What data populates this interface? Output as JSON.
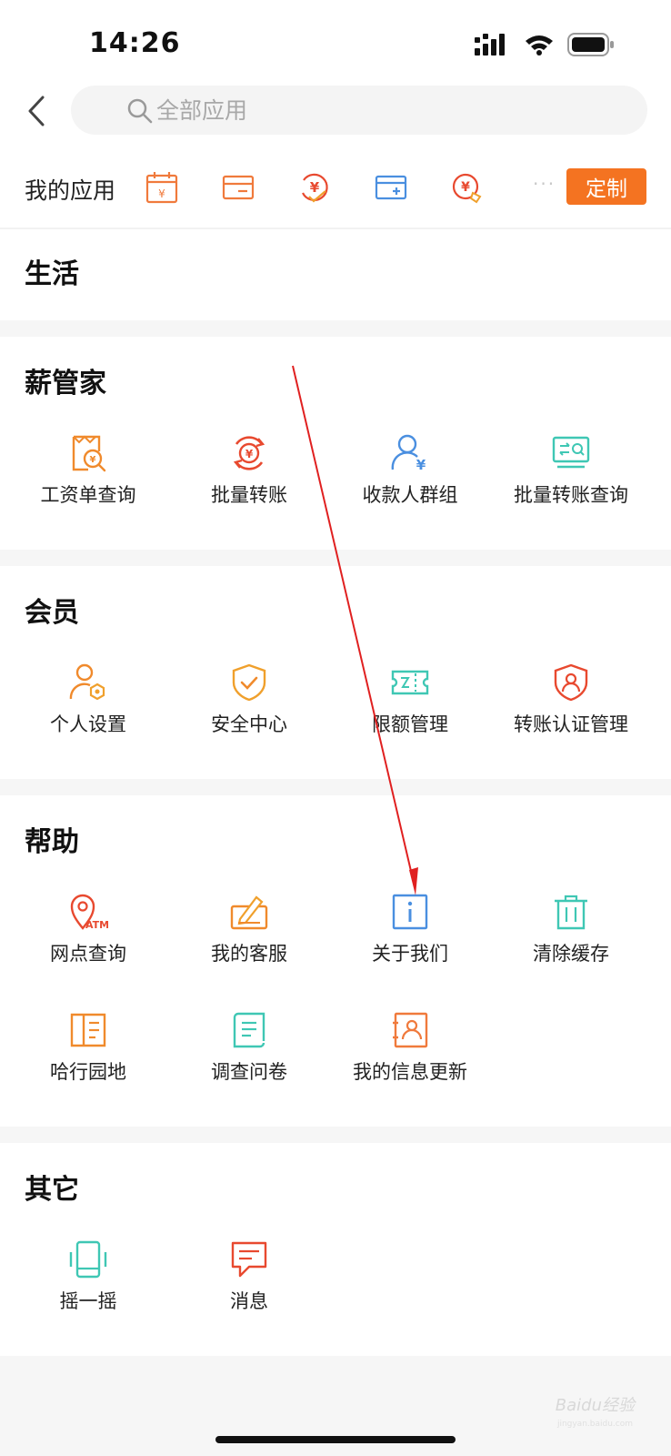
{
  "status_bar": {
    "time": "14:26"
  },
  "search": {
    "placeholder": "全部应用"
  },
  "my_apps": {
    "label": "我的应用",
    "icons": [
      "calendar-yuan-icon",
      "card-icon",
      "yuan-refresh-icon",
      "card-add-icon",
      "yuan-tag-icon"
    ],
    "more": "···",
    "customize_label": "定制"
  },
  "sections": {
    "life": {
      "title": "生活"
    },
    "salary": {
      "title": "薪管家",
      "items": [
        {
          "label": "工资单查询",
          "icon": "payslip-search-icon",
          "color": "#f08a2c"
        },
        {
          "label": "批量转账",
          "icon": "batch-transfer-icon",
          "color": "#e8492f"
        },
        {
          "label": "收款人群组",
          "icon": "payee-group-icon",
          "color": "#4a8fe0"
        },
        {
          "label": "批量转账查询",
          "icon": "batch-query-icon",
          "color": "#3fc7b4"
        }
      ]
    },
    "member": {
      "title": "会员",
      "items": [
        {
          "label": "个人设置",
          "icon": "personal-settings-icon",
          "color": "#f08a2c"
        },
        {
          "label": "安全中心",
          "icon": "security-shield-icon",
          "color": "#f0a02c"
        },
        {
          "label": "限额管理",
          "icon": "limit-ticket-icon",
          "color": "#3fc7b4"
        },
        {
          "label": "转账认证管理",
          "icon": "transfer-auth-icon",
          "color": "#e8492f"
        }
      ]
    },
    "help": {
      "title": "帮助",
      "items": [
        {
          "label": "网点查询",
          "icon": "atm-location-icon",
          "color": "#e8492f"
        },
        {
          "label": "我的客服",
          "icon": "customer-service-icon",
          "color": "#f08a2c"
        },
        {
          "label": "关于我们",
          "icon": "info-icon",
          "color": "#4a8fe0"
        },
        {
          "label": "清除缓存",
          "icon": "trash-icon",
          "color": "#3fc7b4"
        },
        {
          "label": "哈行园地",
          "icon": "book-icon",
          "color": "#f08a2c"
        },
        {
          "label": "调查问卷",
          "icon": "survey-scroll-icon",
          "color": "#3fc7b4"
        },
        {
          "label": "我的信息更新",
          "icon": "profile-card-icon",
          "color": "#f07a3c"
        }
      ]
    },
    "other": {
      "title": "其它",
      "items": [
        {
          "label": "摇一摇",
          "icon": "shake-phone-icon",
          "color": "#3fc7b4"
        },
        {
          "label": "消息",
          "icon": "message-icon",
          "color": "#e8492f"
        }
      ]
    }
  },
  "watermark": {
    "brand": "Baidu经验",
    "url": "jingyan.baidu.com"
  },
  "colors": {
    "accent": "#f47321",
    "section_gap": "#f6f6f6",
    "annotation_arrow": "#e02020"
  }
}
